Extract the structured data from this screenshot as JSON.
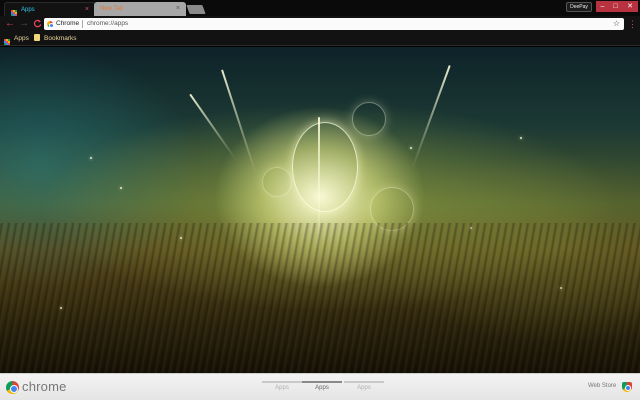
{
  "window": {
    "profile_button": "DeePay",
    "minimize": "–",
    "maximize": "□",
    "close": "✕"
  },
  "tabs": [
    {
      "label": "Apps",
      "active": true,
      "close": "×"
    },
    {
      "label": "New Tab",
      "active": false,
      "close": "×"
    }
  ],
  "toolbar": {
    "back": "←",
    "forward": "→",
    "reload": "C",
    "omnibox_chip": "Chrome",
    "url": "chrome://apps",
    "star": "☆",
    "menu": "⋮"
  },
  "bookmarks_bar": {
    "items": [
      {
        "label": "Apps",
        "icon": "apps-grid-icon"
      },
      {
        "label": "Bookmarks",
        "icon": "folder-icon"
      }
    ]
  },
  "bottom_bar": {
    "brand": "chrome",
    "page_switchers": [
      {
        "label": "Apps",
        "active": false
      },
      {
        "label": "Apps",
        "active": true
      },
      {
        "label": "Apps",
        "active": false
      }
    ],
    "webstore_label": "Web Store"
  },
  "colors": {
    "accent": "#e8485e",
    "active_tab_text": "#33c8f0",
    "inactive_tab_text": "#e07b39",
    "bookmark_text": "#e9d49b"
  }
}
